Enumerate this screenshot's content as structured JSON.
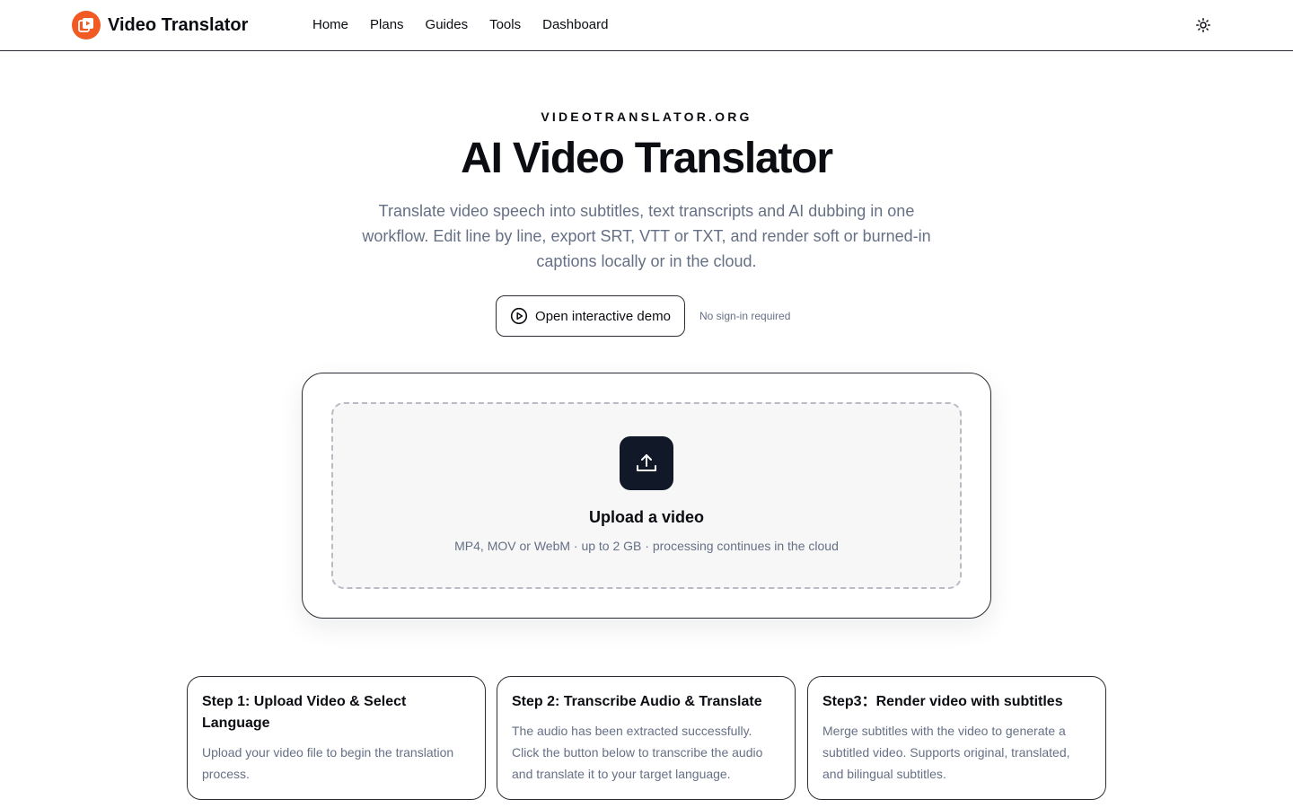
{
  "header": {
    "brand": "Video Translator",
    "nav": [
      "Home",
      "Plans",
      "Guides",
      "Tools",
      "Dashboard"
    ],
    "theme_icon": "sun-icon"
  },
  "hero": {
    "eyebrow": "VIDEOTRANSLATOR.ORG",
    "title": "AI Video Translator",
    "subtitle": "Translate video speech into subtitles, text transcripts and AI dubbing in one workflow. Edit line by line, export SRT, VTT or TXT, and render soft or burned-in captions locally or in the cloud.",
    "demo_button": "Open interactive demo",
    "demo_note": "No sign-in required"
  },
  "upload": {
    "title": "Upload a video",
    "hint": "MP4, MOV or WebM · up to 2 GB · processing continues in the cloud",
    "icon": "upload-icon"
  },
  "steps": [
    {
      "title": "Step 1: Upload Video & Select Language",
      "desc": "Upload your video file to begin the translation process."
    },
    {
      "title": "Step 2: Transcribe Audio & Translate",
      "desc": "The audio has been extracted successfully. Click the button below to transcribe the audio and translate it to your target language."
    },
    {
      "title": "Step3：Render video with subtitles",
      "desc": "Merge subtitles with the video to generate a subtitled video. Supports original, translated, and bilingual subtitles."
    }
  ],
  "colors": {
    "brand": "#f25a24",
    "dark": "#111827",
    "muted": "#667085"
  }
}
